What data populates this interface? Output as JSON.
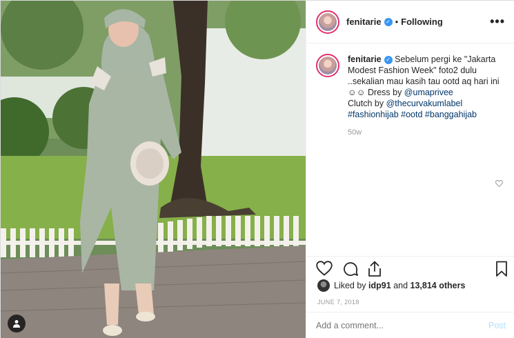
{
  "post": {
    "username": "fenitarie",
    "follow_status": "Following",
    "dot": "•",
    "more": "•••"
  },
  "caption": {
    "username": "fenitarie",
    "text_1": "Sebelum pergi ke \"Jakarta Modest Fashion Week\" foto2 dulu ..sekalian mau kasih tau ootd aq hari ini ☺☺ Dress by ",
    "mention_1": "@umaprivee",
    "text_2": "Clutch by ",
    "mention_2": "@thecurvakumlabel",
    "hashtags": [
      "#fashionhijab",
      "#ootd",
      "#banggahijab"
    ],
    "time": "50w"
  },
  "likes": {
    "liked_by": "Liked by",
    "user": "idp91",
    "and": "and",
    "count": "13,814 others"
  },
  "date": "JUNE 7, 2018",
  "comment": {
    "placeholder": "Add a comment...",
    "post_label": "Post"
  },
  "colors": {
    "accent_blue": "#3897f0",
    "link": "#003569",
    "muted": "#999999",
    "post_disabled": "#b2dffc"
  },
  "icons": {
    "verified": "verified-badge-icon",
    "like": "heart-icon",
    "comment": "comment-bubble-icon",
    "share": "share-icon",
    "save": "bookmark-icon",
    "user_tag": "user-tag-icon"
  }
}
